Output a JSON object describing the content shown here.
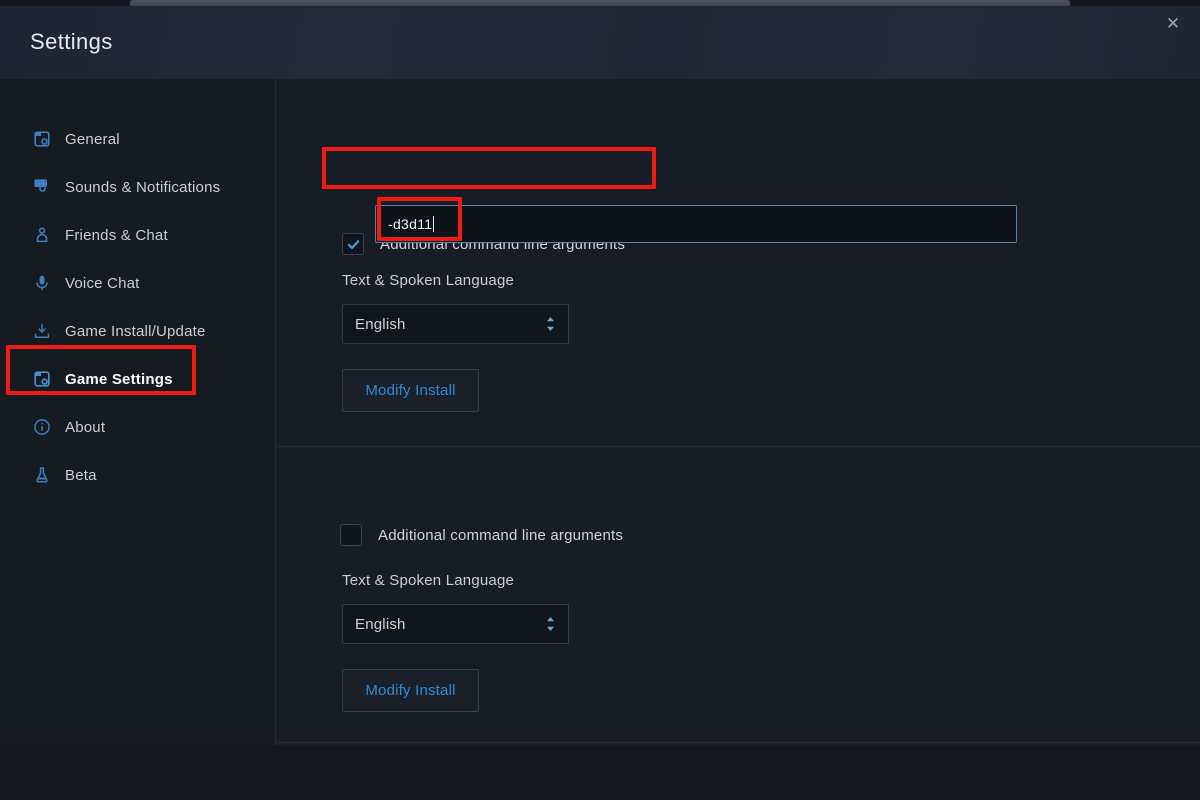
{
  "window": {
    "title": "Settings",
    "close_icon": "close-icon"
  },
  "sidebar": {
    "items": [
      {
        "label": "General",
        "icon": "general-icon",
        "active": false
      },
      {
        "label": "Sounds & Notifications",
        "icon": "sound-notification-icon",
        "active": false
      },
      {
        "label": "Friends & Chat",
        "icon": "friends-chat-icon",
        "active": false
      },
      {
        "label": "Voice Chat",
        "icon": "microphone-icon",
        "active": false
      },
      {
        "label": "Game Install/Update",
        "icon": "download-icon",
        "active": false
      },
      {
        "label": "Game Settings",
        "icon": "game-settings-icon",
        "active": true
      },
      {
        "label": "About",
        "icon": "info-icon",
        "active": false
      },
      {
        "label": "Beta",
        "icon": "beta-flask-icon",
        "active": false
      }
    ]
  },
  "main": {
    "sections": [
      {
        "checkbox_label": "Additional command line arguments",
        "checkbox_checked": true,
        "args_value": "-d3d11",
        "args_placeholder": "",
        "language_label": "Text & Spoken Language",
        "language_value": "English",
        "modify_button": "Modify Install"
      },
      {
        "checkbox_label": "Additional command line arguments",
        "checkbox_checked": false,
        "language_label": "Text & Spoken Language",
        "language_value": "English",
        "modify_button": "Modify Install"
      }
    ]
  },
  "annotations": {
    "color": "#ee1c12",
    "boxes": [
      "checkbox-row-highlight",
      "command-line-value-highlight",
      "sidebar-game-settings-highlight"
    ]
  },
  "colors": {
    "accent_blue": "#2a8cd8",
    "icon_blue": "#3d7fc1",
    "window_bg": "#171b23",
    "sidebar_bg": "#161a21",
    "main_bg": "#181c24",
    "annotation_red": "#ee1c12"
  }
}
